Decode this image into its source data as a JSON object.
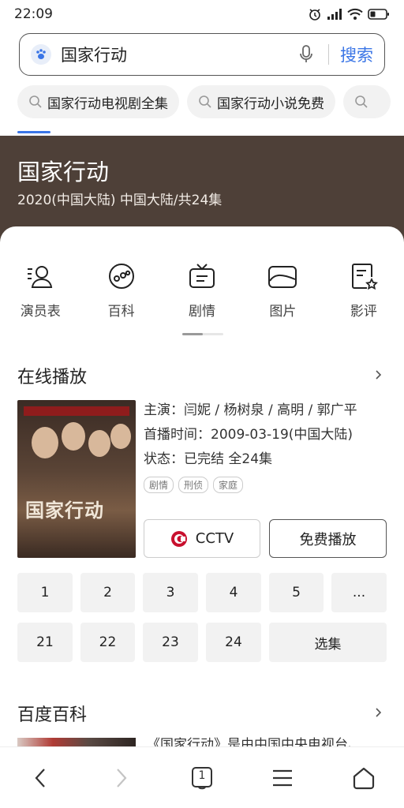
{
  "status_bar": {
    "time": "22:09"
  },
  "search": {
    "query": "国家行动",
    "button_label": "搜索"
  },
  "suggestions": [
    "国家行动电视剧全集",
    "国家行动小说免费",
    ""
  ],
  "hero": {
    "title": "国家行动",
    "subtitle": "2020(中国大陆) 中国大陆/共24集"
  },
  "quick_nav": [
    {
      "label": "演员表",
      "icon": "cast-icon"
    },
    {
      "label": "百科",
      "icon": "encyclopedia-icon"
    },
    {
      "label": "剧情",
      "icon": "tv-plot-icon"
    },
    {
      "label": "图片",
      "icon": "picture-icon"
    },
    {
      "label": "影评",
      "icon": "review-icon"
    }
  ],
  "online": {
    "title": "在线播放",
    "poster_text": "国家行动",
    "starring": "主演：闫妮 / 杨树泉 / 高明 / 郭广平",
    "premiere": "首播时间：2009-03-19(中国大陆)",
    "status": "状态：已完结 全24集",
    "tags": [
      "剧情",
      "刑侦",
      "家庭"
    ],
    "source_label": "CCTV",
    "play_label": "免费播放",
    "episodes_row1": [
      "1",
      "2",
      "3",
      "4",
      "5",
      "..."
    ],
    "episodes_row2": [
      "21",
      "22",
      "23",
      "24"
    ],
    "select_label": "选集"
  },
  "baike": {
    "title": "百度百科",
    "snippet": "《国家行动》是由中国中央电视台、"
  },
  "bottom_nav": {
    "tab_count": "1"
  },
  "colors": {
    "accent": "#3a75e6",
    "hero_bg": "#4e4038"
  }
}
